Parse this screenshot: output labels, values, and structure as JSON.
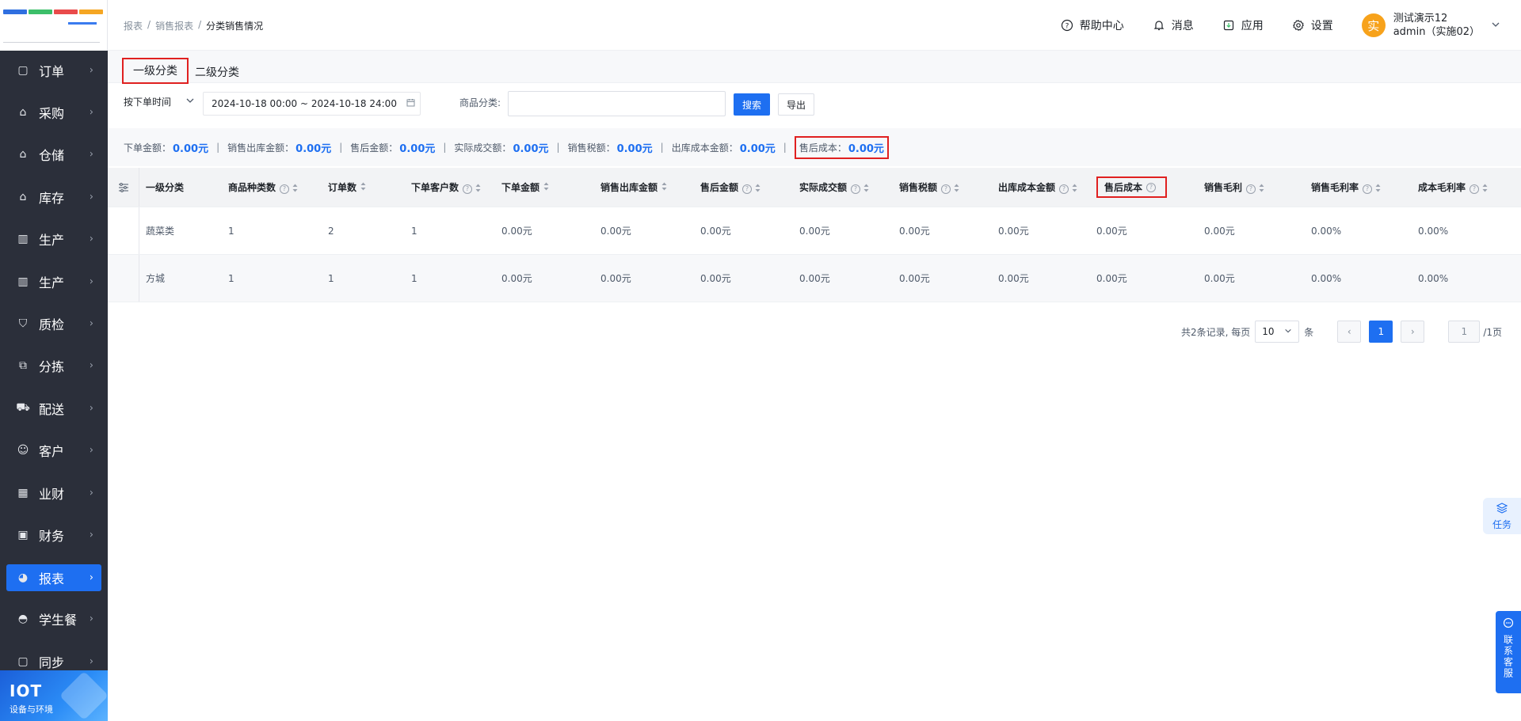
{
  "sidebar": {
    "logo_colors": [
      "#2f6fe0",
      "#3cbf6a",
      "#e94b4b",
      "#f5a623"
    ],
    "items": [
      {
        "label": "订单",
        "icon": "clipboard-icon",
        "glyph": "▢"
      },
      {
        "label": "采购",
        "icon": "shopping-bag-icon",
        "glyph": "⌂"
      },
      {
        "label": "仓储",
        "icon": "warehouse-icon",
        "glyph": "⌂"
      },
      {
        "label": "库存",
        "icon": "inventory-icon",
        "glyph": "⌂"
      },
      {
        "label": "生产",
        "icon": "factory-icon",
        "glyph": "▥"
      },
      {
        "label": "生产",
        "icon": "factory-icon",
        "glyph": "▥"
      },
      {
        "label": "质检",
        "icon": "shield-check-icon",
        "glyph": "⛉"
      },
      {
        "label": "分拣",
        "icon": "sorting-icon",
        "glyph": "⧉"
      },
      {
        "label": "配送",
        "icon": "truck-icon",
        "glyph": "⛟"
      },
      {
        "label": "客户",
        "icon": "users-icon",
        "glyph": "☺"
      },
      {
        "label": "业财",
        "icon": "bar-chart-icon",
        "glyph": "▦"
      },
      {
        "label": "财务",
        "icon": "finance-icon",
        "glyph": "▣"
      },
      {
        "label": "报表",
        "icon": "pie-chart-icon",
        "glyph": "◕",
        "active": true
      },
      {
        "label": "学生餐",
        "icon": "dish-cover-icon",
        "glyph": "◓"
      },
      {
        "label": "同步",
        "icon": "sync-icon",
        "glyph": "▢"
      }
    ],
    "chevron": "›",
    "iot": {
      "title": "IOT",
      "subtitle": "设备与环境"
    }
  },
  "header": {
    "breadcrumb": [
      "报表",
      "销售报表",
      "分类销售情况"
    ],
    "breadcrumb_sep": "/",
    "links": [
      {
        "label": "帮助中心",
        "icon": "help-circle-icon"
      },
      {
        "label": "消息",
        "icon": "bell-icon"
      },
      {
        "label": "应用",
        "icon": "app-download-icon"
      },
      {
        "label": "设置",
        "icon": "gear-icon"
      }
    ],
    "user": {
      "avatar": "实",
      "name": "测试演示12",
      "role": "admin（实施02）"
    }
  },
  "tabs": [
    {
      "label": "一级分类",
      "active": true
    },
    {
      "label": "二级分类",
      "active": false
    }
  ],
  "filters": {
    "time_type": "按下单时间",
    "date_range": "2024-10-18 00:00 ~ 2024-10-18 24:00",
    "category_label": "商品分类:",
    "category_value": "",
    "search_button": "搜索",
    "export_button": "导出"
  },
  "summary": [
    {
      "label": "下单金额：",
      "value": "0.00元"
    },
    {
      "label": "销售出库金额：",
      "value": "0.00元"
    },
    {
      "label": "售后金额：",
      "value": "0.00元"
    },
    {
      "label": "实际成交额：",
      "value": "0.00元"
    },
    {
      "label": "销售税额：",
      "value": "0.00元"
    },
    {
      "label": "出库成本金额：",
      "value": "0.00元"
    },
    {
      "label": "售后成本：",
      "value": "0.00元",
      "highlighted": true
    }
  ],
  "summary_sep": "|",
  "table": {
    "settings_icon": "sliders-icon",
    "columns": [
      {
        "label": "一级分类",
        "help": false,
        "sort": false
      },
      {
        "label": "商品种类数",
        "help": true,
        "sort": true
      },
      {
        "label": "订单数",
        "help": false,
        "sort": true
      },
      {
        "label": "下单客户数",
        "help": true,
        "sort": true
      },
      {
        "label": "下单金额",
        "help": false,
        "sort": true
      },
      {
        "label": "销售出库金额",
        "help": false,
        "sort": true
      },
      {
        "label": "售后金额",
        "help": true,
        "sort": true
      },
      {
        "label": "实际成交额",
        "help": true,
        "sort": true
      },
      {
        "label": "销售税额",
        "help": true,
        "sort": true
      },
      {
        "label": "出库成本金额",
        "help": true,
        "sort": true
      },
      {
        "label": "售后成本",
        "help": true,
        "sort": false,
        "highlighted": true
      },
      {
        "label": "销售毛利",
        "help": true,
        "sort": true
      },
      {
        "label": "销售毛利率",
        "help": true,
        "sort": true
      },
      {
        "label": "成本毛利率",
        "help": true,
        "sort": true
      }
    ],
    "rows": [
      [
        "蔬菜类",
        "1",
        "2",
        "1",
        "0.00元",
        "0.00元",
        "0.00元",
        "0.00元",
        "0.00元",
        "0.00元",
        "0.00元",
        "0.00元",
        "0.00%",
        "0.00%"
      ],
      [
        "方城",
        "1",
        "1",
        "1",
        "0.00元",
        "0.00元",
        "0.00元",
        "0.00元",
        "0.00元",
        "0.00元",
        "0.00元",
        "0.00元",
        "0.00%",
        "0.00%"
      ]
    ]
  },
  "pagination": {
    "records_text": "共2条记录, 每页",
    "page_size": "10",
    "per_unit": "条",
    "prev": "‹",
    "current_page": "1",
    "next": "›",
    "jump_value": "1",
    "total_pages_text": "/1页"
  },
  "floats": {
    "task_label": "任务",
    "support_label": "联系客服"
  },
  "colors": {
    "primary": "#1e6ff1",
    "sidebar_bg": "#2b2f3a",
    "highlight_border": "#e02020",
    "avatar_bg": "#f7a21b"
  }
}
